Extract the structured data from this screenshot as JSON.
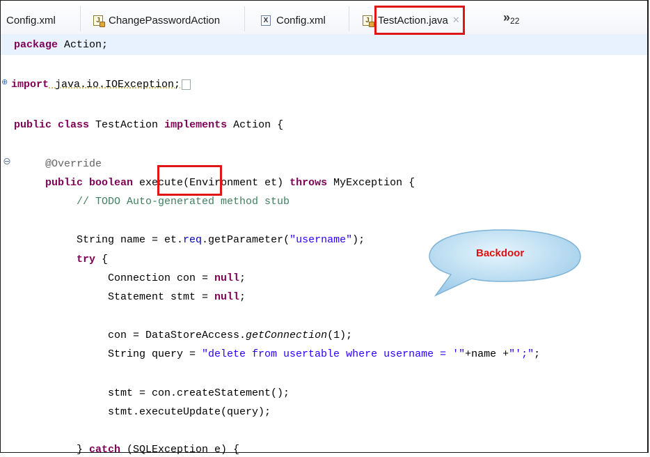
{
  "tabs": [
    {
      "label": "Config.xml",
      "icon": "none"
    },
    {
      "label": "ChangePasswordAction",
      "icon": "java-file-icon"
    },
    {
      "label": "Config.xml",
      "icon": "xml-file-icon"
    },
    {
      "label": "TestAction.java",
      "icon": "java-file-icon",
      "active": true,
      "close": "✕"
    }
  ],
  "overflow": {
    "chevron": "»",
    "count": "22"
  },
  "code": {
    "package": {
      "kw": "package",
      "rest": " Action;"
    },
    "import": {
      "kw": "import",
      "rest": " java.io.IOException;"
    },
    "class": {
      "kw1": "public class",
      "name": " TestAction ",
      "kw2": "implements",
      "rest": " Action {"
    },
    "override": "@Override",
    "method": {
      "kw": "public boolean",
      "name": "execute",
      "params": "(Environment et) ",
      "kw2": "throws",
      "rest": " MyException {"
    },
    "todo": "// TODO Auto-generated method stub",
    "name_decl": {
      "pre": "String name = et.",
      "field": "req",
      "mid": ".getParameter(",
      "str": "\"username\"",
      "post": ");"
    },
    "try": {
      "kw": "try",
      "rest": " {"
    },
    "con_decl": {
      "pre": "Connection con = ",
      "kw": "null",
      "post": ";"
    },
    "stmt_decl": {
      "pre": "Statement stmt = ",
      "kw": "null",
      "post": ";"
    },
    "get_conn": {
      "pre": "con = DataStoreAccess.",
      "method": "getConnection",
      "post": "(1);"
    },
    "query": {
      "pre": "String query = ",
      "str1": "\"delete from usertable where username = '\"",
      "mid": "+name +",
      "str2": "\"';\"",
      "post": ";"
    },
    "create_stmt": "stmt = con.createStatement();",
    "exec_update": "stmt.executeUpdate(query);",
    "catch": {
      "pre": "} ",
      "kw": "catch",
      "rest": " (SQLException e) {"
    }
  },
  "callout": {
    "label": "Backdoor"
  },
  "colors": {
    "highlight": "#e01515",
    "keyword": "#7f0055",
    "string": "#2a00ff",
    "comment": "#3f7f5f",
    "callout_fill": "#b8def4"
  }
}
